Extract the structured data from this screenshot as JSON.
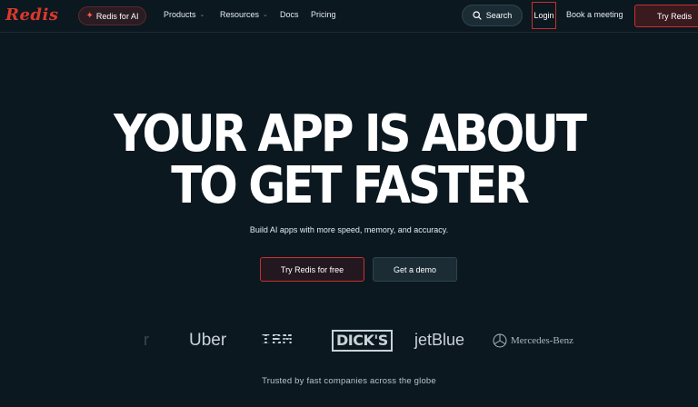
{
  "nav": {
    "logo": "Redis",
    "ai_pill": "Redis for AI",
    "products": "Products",
    "resources": "Resources",
    "docs": "Docs",
    "pricing": "Pricing",
    "search": "Search",
    "login": "Login",
    "book_meeting": "Book a meeting",
    "try_redis": "Try Redis"
  },
  "hero": {
    "title_line1": "YOUR APP IS ABOUT",
    "title_line2": "TO GET FASTER",
    "subtitle": "Build AI apps with more speed, memory, and accuracy.",
    "cta_primary": "Try Redis for free",
    "cta_secondary": "Get a demo"
  },
  "logos": {
    "fade": "r",
    "uber": "Uber",
    "ibm": "IBM",
    "dicks": "DICK'S",
    "jetblue": "jetBlue",
    "mercedes": "Mercedes-Benz"
  },
  "trusted": "Trusted by fast companies across the globe",
  "colors": {
    "background": "#0b1820",
    "brand_red": "#dc382c",
    "text": "#ffffff"
  }
}
